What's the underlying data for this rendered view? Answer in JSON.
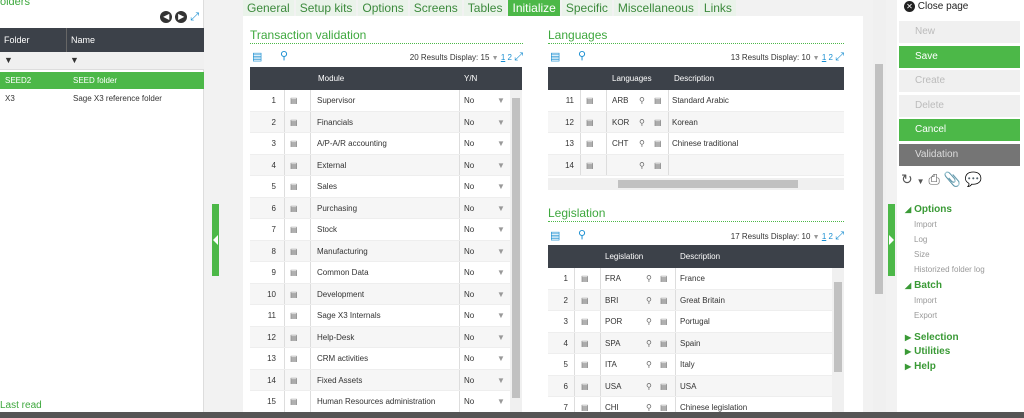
{
  "left": {
    "title": "olders",
    "col_folder": "Folder",
    "col_name": "Name",
    "rows": [
      {
        "folder": "SEED2",
        "name": "SEED folder"
      },
      {
        "folder": "X3",
        "name": "Sage X3 reference folder"
      }
    ],
    "footer": "Last read"
  },
  "tabs": [
    "General",
    "Setup kits",
    "Options",
    "Screens",
    "Tables",
    "Initialize",
    "Specific",
    "Miscellaneous",
    "Links"
  ],
  "transaction": {
    "title": "Transaction validation",
    "results": "20 Results",
    "display_label": "Display:",
    "display_value": "15",
    "pages": [
      "1",
      "2"
    ],
    "col_module": "Module",
    "col_yn": "Y/N",
    "rows": [
      {
        "n": "1",
        "module": "Supervisor",
        "yn": "No"
      },
      {
        "n": "2",
        "module": "Financials",
        "yn": "No"
      },
      {
        "n": "3",
        "module": "A/P-A/R accounting",
        "yn": "No"
      },
      {
        "n": "4",
        "module": "External",
        "yn": "No"
      },
      {
        "n": "5",
        "module": "Sales",
        "yn": "No"
      },
      {
        "n": "6",
        "module": "Purchasing",
        "yn": "No"
      },
      {
        "n": "7",
        "module": "Stock",
        "yn": "No"
      },
      {
        "n": "8",
        "module": "Manufacturing",
        "yn": "No"
      },
      {
        "n": "9",
        "module": "Common Data",
        "yn": "No"
      },
      {
        "n": "10",
        "module": "Development",
        "yn": "No"
      },
      {
        "n": "11",
        "module": "Sage X3 Internals",
        "yn": "No"
      },
      {
        "n": "12",
        "module": "Help-Desk",
        "yn": "No"
      },
      {
        "n": "13",
        "module": "CRM activities",
        "yn": "No"
      },
      {
        "n": "14",
        "module": "Fixed Assets",
        "yn": "No"
      },
      {
        "n": "15",
        "module": "Human Resources administration",
        "yn": "No"
      }
    ]
  },
  "languages": {
    "title": "Languages",
    "results": "13 Results",
    "display_label": "Display:",
    "display_value": "10",
    "pages": [
      "1",
      "2"
    ],
    "col_lang": "Languages",
    "col_desc": "Description",
    "rows": [
      {
        "n": "11",
        "code": "ARB",
        "desc": "Standard Arabic"
      },
      {
        "n": "12",
        "code": "KOR",
        "desc": "Korean"
      },
      {
        "n": "13",
        "code": "CHT",
        "desc": "Chinese traditional"
      },
      {
        "n": "14",
        "code": "",
        "desc": ""
      }
    ]
  },
  "legislation": {
    "title": "Legislation",
    "results": "17 Results",
    "display_label": "Display:",
    "display_value": "10",
    "pages": [
      "1",
      "2"
    ],
    "col_leg": "Legislation",
    "col_desc": "Description",
    "rows": [
      {
        "n": "1",
        "code": "FRA",
        "desc": "France"
      },
      {
        "n": "2",
        "code": "BRI",
        "desc": "Great Britain"
      },
      {
        "n": "3",
        "code": "POR",
        "desc": "Portugal"
      },
      {
        "n": "4",
        "code": "SPA",
        "desc": "Spain"
      },
      {
        "n": "5",
        "code": "ITA",
        "desc": "Italy"
      },
      {
        "n": "6",
        "code": "USA",
        "desc": "USA"
      },
      {
        "n": "7",
        "code": "CHI",
        "desc": "Chinese legislation"
      }
    ]
  },
  "right": {
    "close": "Close page",
    "buttons": [
      "New",
      "Save",
      "Create",
      "Delete",
      "Cancel",
      "Validation"
    ],
    "options_title": "Options",
    "options": [
      "Import",
      "Log",
      "Size",
      "Historized folder log"
    ],
    "batch_title": "Batch",
    "batch": [
      "Import",
      "Export"
    ],
    "selection": "Selection",
    "utilities": "Utilities",
    "help": "Help"
  }
}
